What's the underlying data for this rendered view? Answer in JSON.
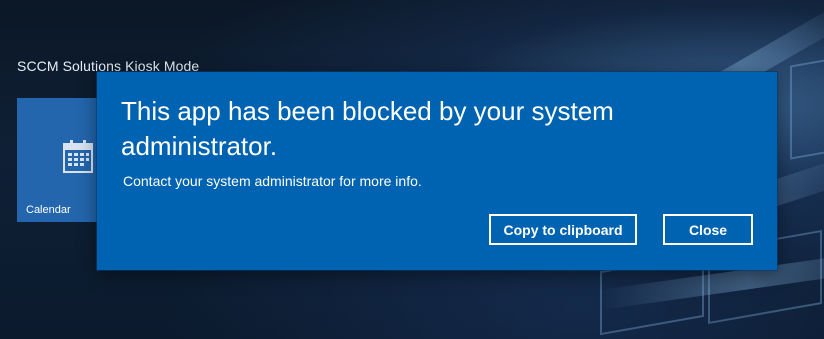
{
  "start": {
    "title": "SCCM Solutions Kiosk Mode",
    "tiles": [
      {
        "label": "Calendar",
        "icon": "calendar-icon",
        "color": "#2366ad"
      }
    ]
  },
  "dialog": {
    "title": "This app has been blocked by your system administrator.",
    "message": "Contact your system administrator for more info.",
    "buttons": {
      "copy_label": "Copy to clipboard",
      "close_label": "Close"
    },
    "background_color": "#0063b1"
  }
}
